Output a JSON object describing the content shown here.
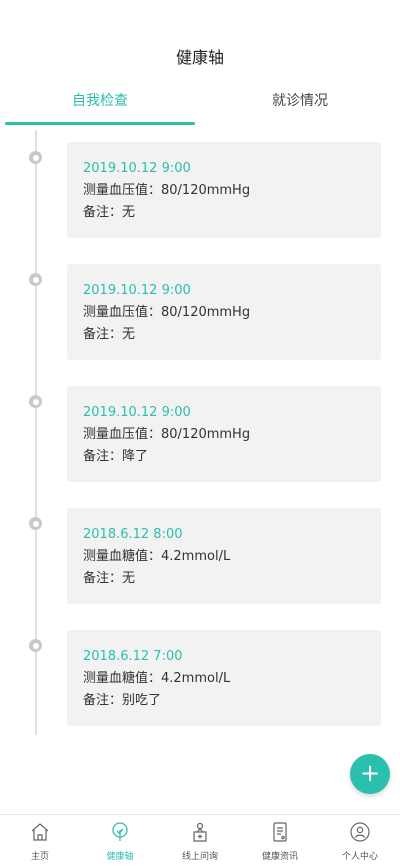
{
  "header": {
    "title": "健康轴"
  },
  "tabs": [
    {
      "label": "自我检查",
      "active": true
    },
    {
      "label": "就诊情况",
      "active": false
    }
  ],
  "entries": [
    {
      "datetime": "2019.10.12 9:00",
      "measure": "测量血压值：80/120mmHg",
      "note": "备注：无"
    },
    {
      "datetime": "2019.10.12 9:00",
      "measure": "测量血压值：80/120mmHg",
      "note": "备注：无"
    },
    {
      "datetime": "2019.10.12 9:00",
      "measure": "测量血压值：80/120mmHg",
      "note": "备注：降了"
    },
    {
      "datetime": "2018.6.12 8:00",
      "measure": "测量血糖值：4.2mmol/L",
      "note": "备注：无"
    },
    {
      "datetime": "2018.6.12 7:00",
      "measure": "测量血糖值：4.2mmol/L",
      "note": "备注：别吃了"
    }
  ],
  "fab": {
    "symbol": "+",
    "icon": "plus-icon"
  },
  "bottom_nav": [
    {
      "label": "主页",
      "icon": "home-icon",
      "active": false
    },
    {
      "label": "健康轴",
      "icon": "tree-icon",
      "active": true
    },
    {
      "label": "线上问询",
      "icon": "consult-icon",
      "active": false
    },
    {
      "label": "健康资讯",
      "icon": "news-icon",
      "active": false
    },
    {
      "label": "个人中心",
      "icon": "user-icon",
      "active": false
    }
  ],
  "colors": {
    "accent": "#2bbfae",
    "card_bg": "#f2f2f2",
    "timeline": "#e0e0e0",
    "nav_inactive": "#555555"
  }
}
